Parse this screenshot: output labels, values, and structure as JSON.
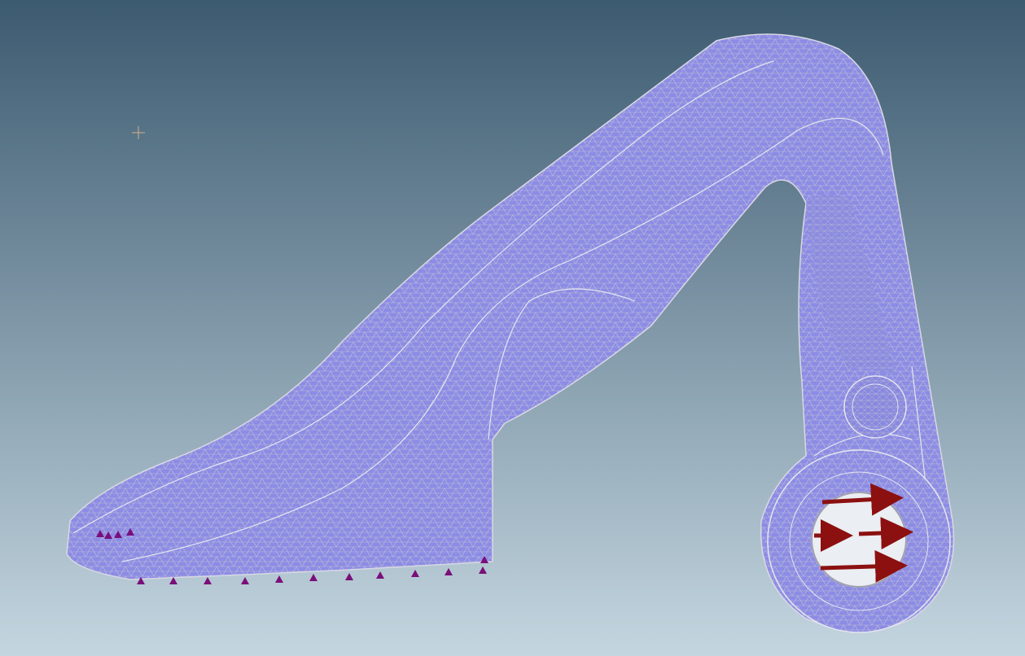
{
  "viewport": {
    "background_top": "#3c5a70",
    "background_bottom": "#c4d6e0",
    "mesh_fill": "#8c8ce6",
    "mesh_line": "#c8c8d0",
    "feature_edge": "#e6e6f0",
    "constraint_color": "#7a0f7a",
    "load_color": "#8c1010"
  }
}
